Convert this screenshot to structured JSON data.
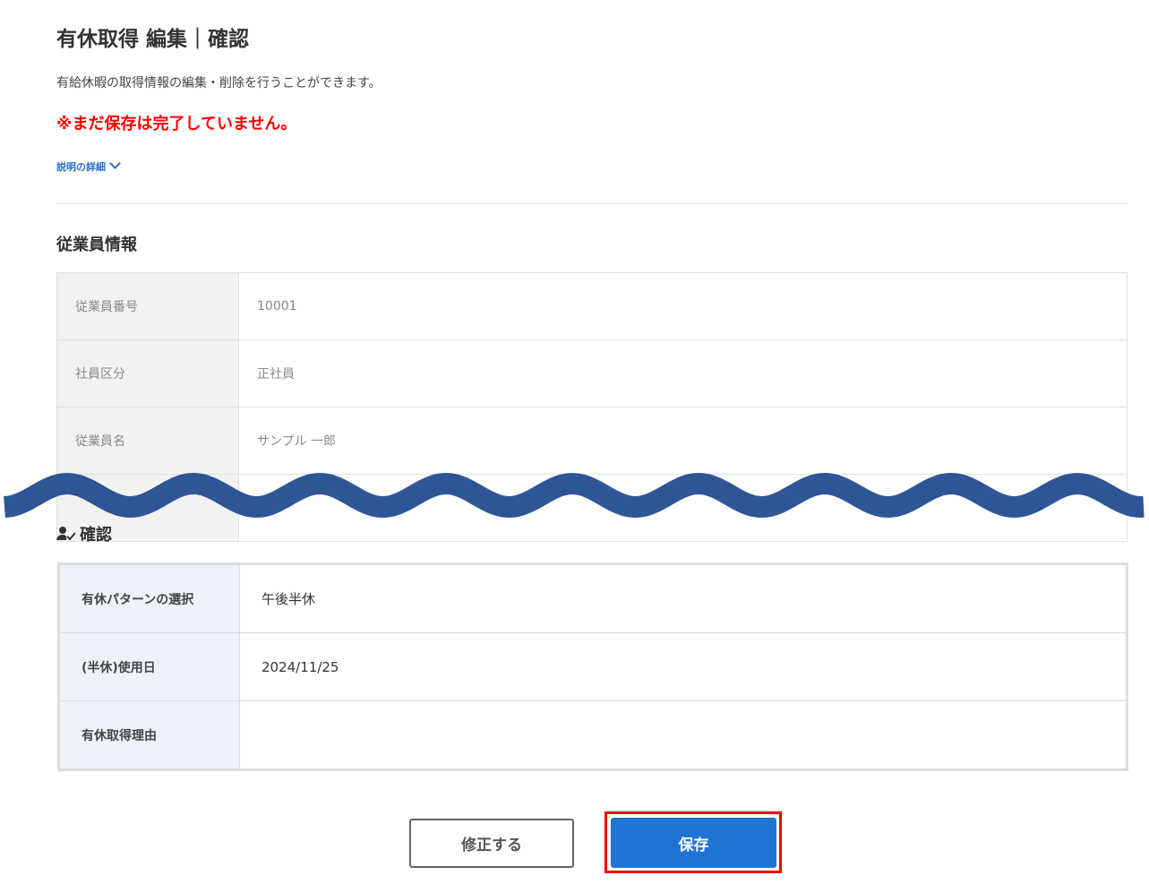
{
  "header": {
    "title": "有休取得 編集｜確認",
    "description": "有給休暇の取得情報の編集・削除を行うことができます。",
    "warning": "※まだ保存は完了していません。",
    "details_link": "説明の詳細"
  },
  "employee_section": {
    "title": "従業員情報",
    "rows": [
      {
        "label": "従業員番号",
        "value": "10001"
      },
      {
        "label": "社員区分",
        "value": "正社員"
      },
      {
        "label": "従業員名",
        "value": "サンプル 一郎"
      }
    ]
  },
  "confirm_section": {
    "title": "確認",
    "icon": "user-check-icon",
    "rows": [
      {
        "label": "有休パターンの選択",
        "value": "午後半休"
      },
      {
        "label": "(半休)使用日",
        "value": "2024/11/25"
      },
      {
        "label": "有休取得理由",
        "value": ""
      }
    ]
  },
  "buttons": {
    "fix": "修正する",
    "save": "保存"
  },
  "colors": {
    "wave": "#2e5596",
    "accent": "#1f74d4",
    "warning": "#ff0000"
  }
}
